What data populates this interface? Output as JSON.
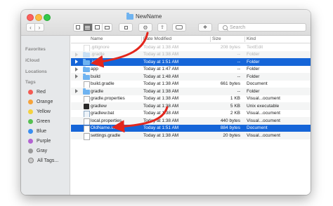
{
  "window": {
    "title": "NewName"
  },
  "toolbar": {
    "search_placeholder": "Search",
    "back_label": "‹",
    "forward_label": "›"
  },
  "sidebar": {
    "favorites_heading": "Favorites",
    "icloud_heading": "iCloud",
    "locations_heading": "Locations",
    "tags_heading": "Tags",
    "tags": [
      {
        "label": "Red",
        "color": "#f45a52"
      },
      {
        "label": "Orange",
        "color": "#f6a33a"
      },
      {
        "label": "Yellow",
        "color": "#f4d13f"
      },
      {
        "label": "Green",
        "color": "#56c051"
      },
      {
        "label": "Blue",
        "color": "#3a8ff2"
      },
      {
        "label": "Purple",
        "color": "#b363d2"
      },
      {
        "label": "Gray",
        "color": "#9a9a9a"
      },
      {
        "label": "All Tags..."
      }
    ]
  },
  "columns": {
    "name": "Name",
    "date": "Date Modified",
    "size": "Size",
    "kind": "Kind"
  },
  "files": [
    {
      "name": ".gitignore",
      "date": "Today at 1:38 AM",
      "size": "208 bytes",
      "kind": "TextEdit"
    },
    {
      "name": ".gradle",
      "date": "Today at 1:38 AM",
      "size": "--",
      "kind": "Folder"
    },
    {
      "name": ".idea",
      "date": "Today at 1:51 AM",
      "size": "--",
      "kind": "Folder"
    },
    {
      "name": "app",
      "date": "Today at 1:47 AM",
      "size": "--",
      "kind": "Folder"
    },
    {
      "name": "build",
      "date": "Today at 1:48 AM",
      "size": "--",
      "kind": "Folder"
    },
    {
      "name": "build.gradle",
      "date": "Today at 1:38 AM",
      "size": "661 bytes",
      "kind": "Document"
    },
    {
      "name": "gradle",
      "date": "Today at 1:38 AM",
      "size": "--",
      "kind": "Folder"
    },
    {
      "name": "gradle.properties",
      "date": "Today at 1:38 AM",
      "size": "1 KB",
      "kind": "Visual...ocument"
    },
    {
      "name": "gradlew",
      "date": "Today at 1:38 AM",
      "size": "5 KB",
      "kind": "Unix executable"
    },
    {
      "name": "gradlew.bat",
      "date": "Today at 1:38 AM",
      "size": "2 KB",
      "kind": "Visual...ocument"
    },
    {
      "name": "local.properties",
      "date": "Today at 1:38 AM",
      "size": "440 bytes",
      "kind": "Visual...ocument"
    },
    {
      "name": "OldName.iml",
      "date": "Today at 1:51 AM",
      "size": "884 bytes",
      "kind": "Document"
    },
    {
      "name": "settings.gradle",
      "date": "Today at 1:38 AM",
      "size": "20 bytes",
      "kind": "Visual...ocument"
    }
  ],
  "colors": {
    "selection": "#1565d8",
    "arrow": "#e3261c"
  }
}
